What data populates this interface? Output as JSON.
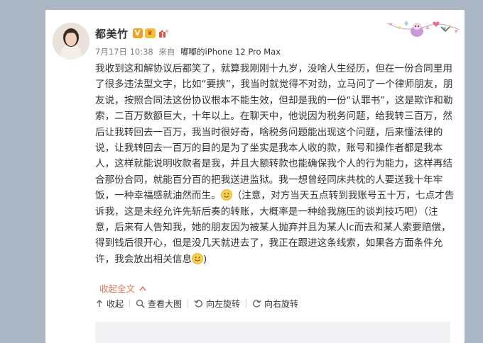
{
  "post": {
    "author": "都美竹",
    "badge_v": "V",
    "date": "7月17日 10:38",
    "source_prefix": "来自",
    "device": "嘟嘟的iPhone 12 Pro Max",
    "paragraphs": [
      "我收到这和解协议后都笑了，就算我刚刚十九岁，没啥人生经历，但在一份合同里用了很多违法型文字，比如“要挟”，我当时就觉得不对劲，立马问了一个律师朋友，朋友说，按照合同法这份协议根本不能生效，但却是我的一份“认罪书”，这是欺诈和勒索，二百万数额巨大，十年以上。在聊天中，他说因为税务问题，给我转三百万，然后让我转回去一百万，我当时很好奇，啥税务问题能出现这个问题，后来懂法律的说，让我转回去一百万的目的是为了坐实是我本人收的款，账号和操作者都是我本人，这样就能说明收款者是我，并且大额转款也能确保我个人的行为能力，这样再结合那份合同，就能百分百的把我送进监狱。我一想曾经同床共枕的人要送我十年牢饭，一种幸福感就油然而生。",
      "（注意，对方当天五点转到我账号五十万，七点才告诉我，这是未经允许先斩后奏的转账，大概率是一种给我施压的谈判技巧吧）（注意，后来有人告知我，她的朋友因为被某人抛弃并且为某人lc而去和某人索要赔偿，得到钱后很开心，但是没几天就进去了，我正在跟进这条线索，如果各方面条件允许，我会放出相关信息",
      ")"
    ],
    "collapse_label": "收起全文",
    "actions": {
      "collapse": "收起",
      "view_large": "查看大图",
      "rotate_left": "向左旋转",
      "rotate_right": "向右旋转"
    }
  },
  "colors": {
    "accent": "#eb7350",
    "badge_gold": "#f1a11b",
    "text": "#333333",
    "meta": "#808080",
    "background": "#aab6c4"
  }
}
